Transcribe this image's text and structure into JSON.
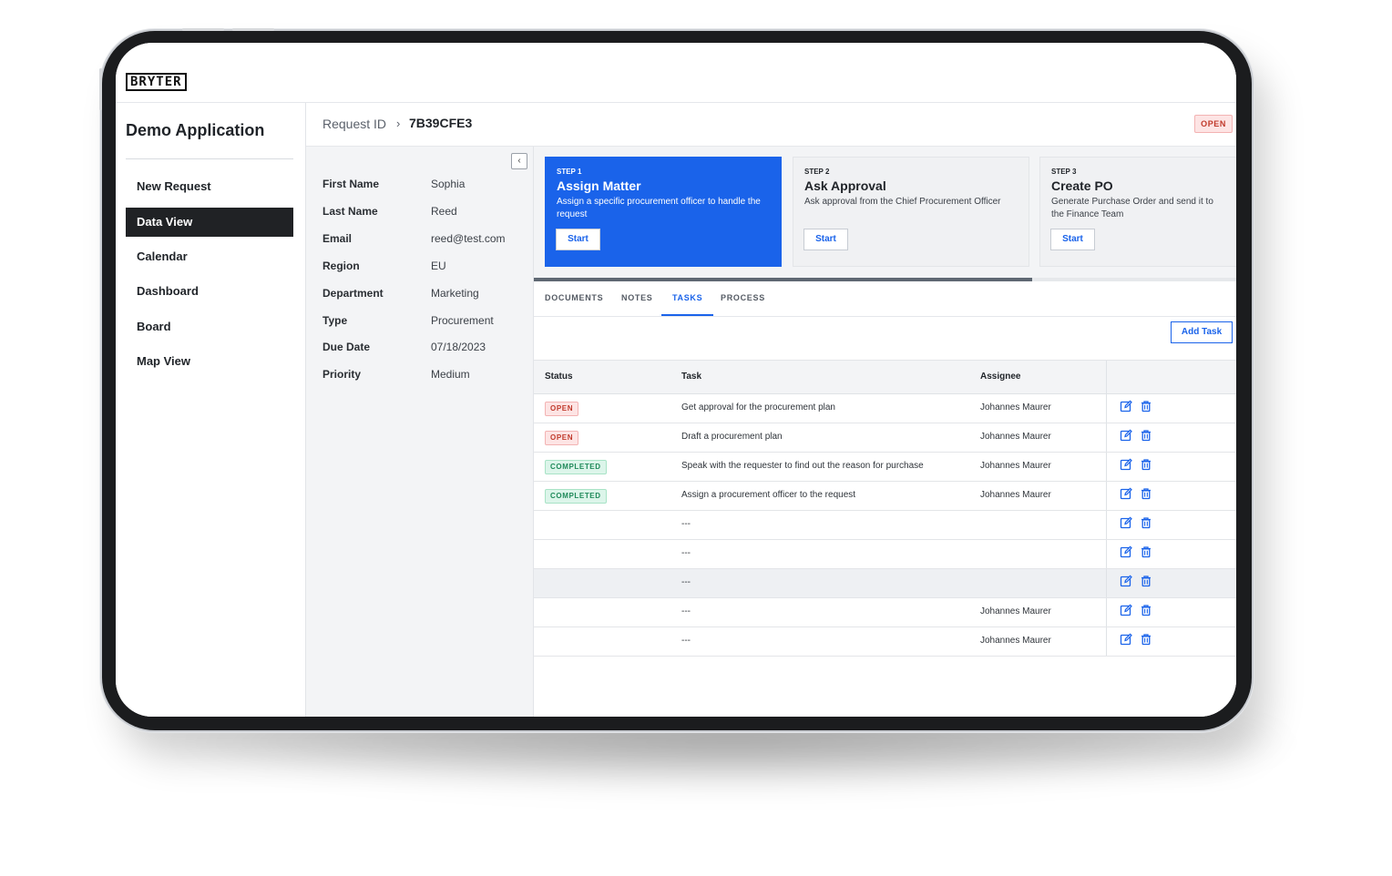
{
  "logo": {
    "text": "BRYTER"
  },
  "app": {
    "title": "Demo Application"
  },
  "nav": {
    "items": [
      {
        "label": "New Request",
        "active": false
      },
      {
        "label": "Data View",
        "active": true
      },
      {
        "label": "Calendar",
        "active": false
      },
      {
        "label": "Dashboard",
        "active": false
      },
      {
        "label": "Board",
        "active": false
      },
      {
        "label": "Map View",
        "active": false
      }
    ]
  },
  "request": {
    "label": "Request ID",
    "separator": "›",
    "id": "7B39CFE3",
    "status": "OPEN"
  },
  "details": {
    "collapse_icon": "chevron-left-icon",
    "rows": [
      {
        "label": "First Name",
        "value": "Sophia"
      },
      {
        "label": "Last Name",
        "value": "Reed"
      },
      {
        "label": "Email",
        "value": "reed@test.com"
      },
      {
        "label": "Region",
        "value": "EU"
      },
      {
        "label": "Department",
        "value": "Marketing"
      },
      {
        "label": "Type",
        "value": "Procurement"
      },
      {
        "label": "Due Date",
        "value": "07/18/2023"
      },
      {
        "label": "Priority",
        "value": "Medium"
      }
    ]
  },
  "steps": [
    {
      "num": "STEP 1",
      "title": "Assign Matter",
      "desc": "Assign a specific procurement officer to handle the request",
      "button": "Start",
      "active": true
    },
    {
      "num": "STEP 2",
      "title": "Ask Approval",
      "desc": "Ask approval from the Chief Procurement Officer",
      "button": "Start",
      "active": false
    },
    {
      "num": "STEP 3",
      "title": "Create PO",
      "desc": "Generate Purchase Order and send it to the Finance Team",
      "button": "Start",
      "active": false
    }
  ],
  "progress": {
    "fraction": 0.71
  },
  "tabs": [
    {
      "label": "DOCUMENTS",
      "active": false
    },
    {
      "label": "NOTES",
      "active": false
    },
    {
      "label": "TASKS",
      "active": true
    },
    {
      "label": "PROCESS",
      "active": false
    }
  ],
  "tasks": {
    "add_button": "Add Task",
    "columns": {
      "status": "Status",
      "task": "Task",
      "assignee": "Assignee"
    },
    "rows": [
      {
        "status": "OPEN",
        "task": "Get approval for the procurement plan",
        "assignee": "Johannes Maurer"
      },
      {
        "status": "OPEN",
        "task": "Draft a procurement plan",
        "assignee": "Johannes Maurer"
      },
      {
        "status": "COMPLETED",
        "task": "Speak with the requester to find out the reason for purchase",
        "assignee": "Johannes Maurer"
      },
      {
        "status": "COMPLETED",
        "task": "Assign a procurement officer to the request",
        "assignee": "Johannes Maurer"
      },
      {
        "status": "",
        "task": "---",
        "assignee": ""
      },
      {
        "status": "",
        "task": "---",
        "assignee": ""
      },
      {
        "status": "",
        "task": "---",
        "assignee": ""
      },
      {
        "status": "",
        "task": "---",
        "assignee": "Johannes Maurer"
      },
      {
        "status": "",
        "task": "---",
        "assignee": "Johannes Maurer"
      }
    ],
    "row_icons": [
      "edit-icon",
      "trash-icon"
    ]
  },
  "colors": {
    "accent": "#1a63ea",
    "nav_active": "#202225",
    "open_badge": "#fde4e4",
    "completed_badge": "#dcf5ea"
  }
}
